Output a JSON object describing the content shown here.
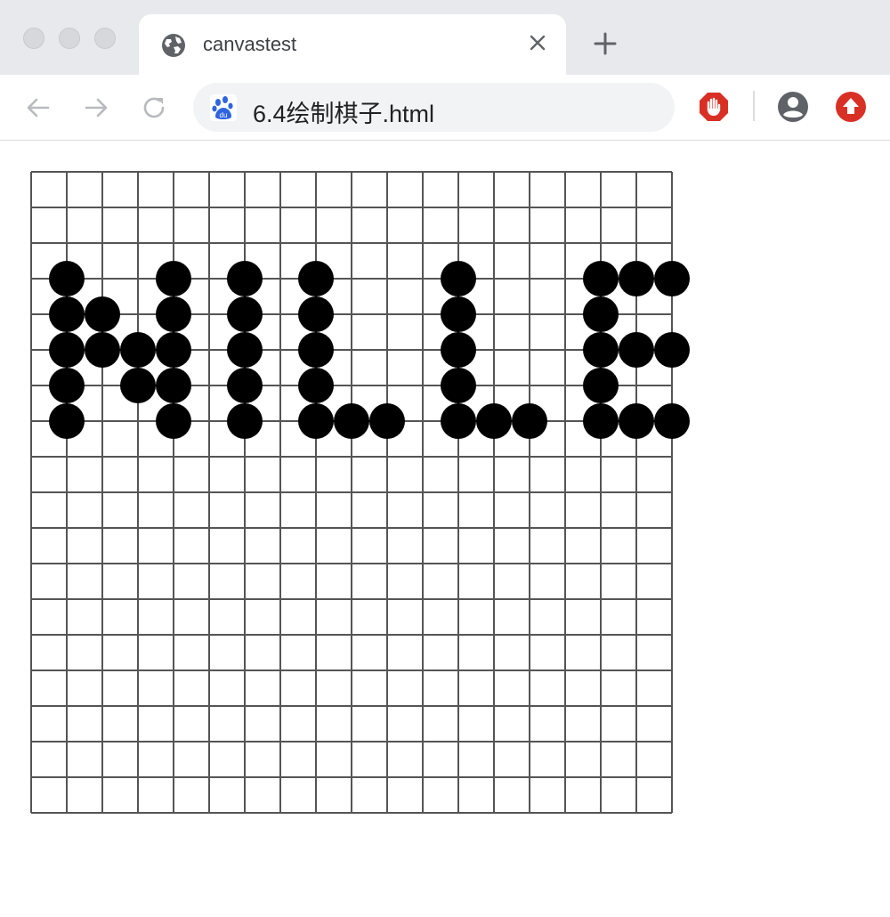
{
  "window": {
    "tab_title": "canvastest",
    "tab_icon": "globe-icon",
    "new_tab_icon": "plus-icon",
    "close_icon": "close-icon"
  },
  "toolbar": {
    "url": "6.4绘制棋子.html",
    "site_icon": "baidu-paw-icon",
    "back_icon": "arrow-left-icon",
    "forward_icon": "arrow-right-icon",
    "reload_icon": "reload-icon",
    "extensions": [
      {
        "name": "adblock-hand-icon",
        "color": "#d93025"
      },
      {
        "name": "account-icon",
        "color": "#5f6368"
      },
      {
        "name": "upload-arrow-icon",
        "color": "#d93025"
      }
    ]
  },
  "board": {
    "grid_cells": 18,
    "line_color": "#555555",
    "stone_color": "#000000",
    "stones": [
      [
        1,
        3
      ],
      [
        1,
        4
      ],
      [
        1,
        5
      ],
      [
        1,
        6
      ],
      [
        1,
        7
      ],
      [
        2,
        4
      ],
      [
        2,
        5
      ],
      [
        3,
        5
      ],
      [
        3,
        6
      ],
      [
        4,
        3
      ],
      [
        4,
        4
      ],
      [
        4,
        5
      ],
      [
        4,
        6
      ],
      [
        4,
        7
      ],
      [
        6,
        3
      ],
      [
        6,
        4
      ],
      [
        6,
        5
      ],
      [
        6,
        6
      ],
      [
        6,
        7
      ],
      [
        8,
        3
      ],
      [
        8,
        4
      ],
      [
        8,
        5
      ],
      [
        8,
        6
      ],
      [
        8,
        7
      ],
      [
        9,
        7
      ],
      [
        10,
        7
      ],
      [
        12,
        3
      ],
      [
        12,
        4
      ],
      [
        12,
        5
      ],
      [
        12,
        6
      ],
      [
        12,
        7
      ],
      [
        13,
        7
      ],
      [
        14,
        7
      ],
      [
        16,
        3
      ],
      [
        16,
        4
      ],
      [
        16,
        5
      ],
      [
        16,
        6
      ],
      [
        16,
        7
      ],
      [
        17,
        3
      ],
      [
        18,
        3
      ],
      [
        17,
        5
      ],
      [
        18,
        5
      ],
      [
        17,
        7
      ],
      [
        18,
        7
      ]
    ]
  }
}
